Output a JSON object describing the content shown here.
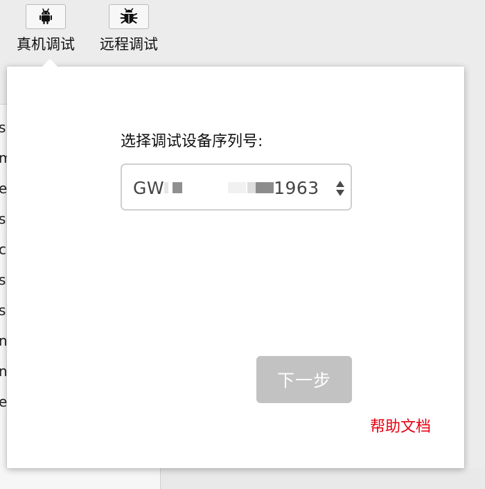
{
  "toolbar": {
    "real_device": {
      "label": "真机调试",
      "icon": "android-icon"
    },
    "remote_debug": {
      "label": "远程调试",
      "icon": "bug-icon"
    }
  },
  "background_list": {
    "fragments": [
      "s",
      "m",
      "e",
      "s",
      "cs",
      "s",
      "s",
      "nt",
      "nt",
      "ec"
    ]
  },
  "popover": {
    "field_label": "选择调试设备序列号:",
    "device_select": {
      "value_prefix": "GW",
      "value_suffix": "1963"
    },
    "next_button": "下一步",
    "help_link": "帮助文档"
  },
  "colors": {
    "help_link": "#e60012",
    "button_disabled_bg": "#c2c2c2",
    "toolbar_bg": "#ececec"
  }
}
